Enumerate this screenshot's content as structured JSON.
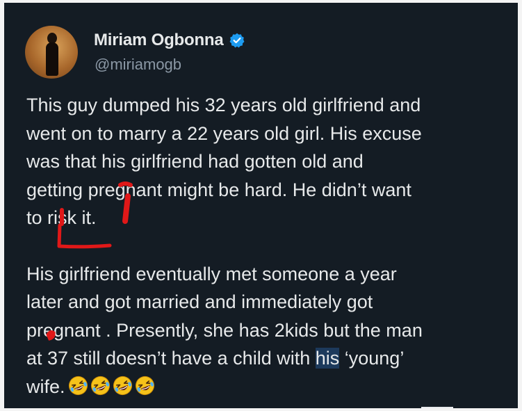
{
  "post": {
    "author": {
      "display_name": "Miriam Ogbonna",
      "handle": "@miriamogb",
      "verified": true,
      "verified_icon": "verified-badge-icon"
    },
    "text": {
      "paragraph1": {
        "line1": "This guy dumped his 32 years old girlfriend and",
        "line2": "went on to marry a 22 years old girl. His excuse",
        "line3": "was that his girlfriend had gotten old and",
        "line4": "getting pregnant might be hard.  He didn’t want",
        "line5": "to risk it."
      },
      "paragraph2": {
        "line1": "His girlfriend eventually met someone a year",
        "line2": "later and got married and immediately got",
        "line3": "pregnant . Presently, she has 2kids but the man",
        "line4_before": "at 37 still doesn’t have a child with ",
        "line4_highlight": "his",
        "line4_after": " ‘young’",
        "line5": "wife."
      },
      "emoji_count": 4,
      "emoji_icon": "rolling-on-floor-laughing-icon"
    }
  },
  "colors": {
    "background": "#141c24",
    "text": "#e7e9ea",
    "secondary_text": "#8b98a5",
    "verified_blue": "#1d9bf0",
    "selection_highlight": "#1d3a5c",
    "annotation_red": "#e01818"
  }
}
